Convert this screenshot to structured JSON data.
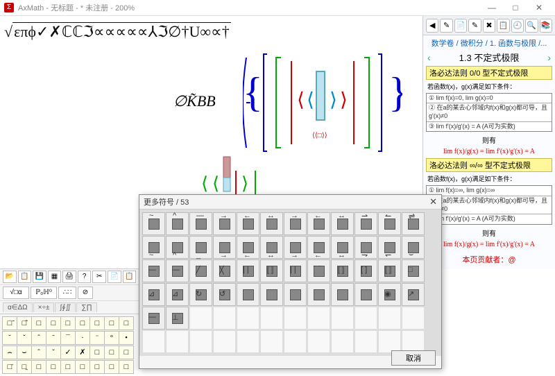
{
  "title": "AxMath - 无标题 - * 未注册 - 200%",
  "window": {
    "min": "—",
    "max": "□",
    "close": "✕"
  },
  "formula_text": "επϕ✓✗ℂℂℑ∝∝∝∝∝⅄ℑ∅†U∞∝†",
  "formula2": "∅K̃BB",
  "side": {
    "icons": [
      "◀",
      "✎",
      "📄",
      "✎",
      "✖",
      "📋",
      "🕘",
      "🔍",
      "📚"
    ],
    "crumb": "数学卷 / 微积分 / 1. 函数与极限 /...",
    "heading": "1.3 不定式极限",
    "rule1": "洛必达法则 0/0 型不定式极限",
    "cond1a": "若函数f(x)，g(x)满足如下条件：",
    "cond1b": "① lim f(x)=0, lim g(x)=0",
    "cond1c": "② 在a的某去心邻域内f(x)和g(x)都可导，且g'(x)≠0",
    "cond1d": "③ lim f'(x)/g'(x) = A  (A可为实数)",
    "then": "则有",
    "eq1": "lim f(x)/g(x) = lim f'(x)/g'(x) = A",
    "rule2": "洛必达法则 ∞/∞ 型不定式极限",
    "cond2a": "若函数f(x)，g(x)满足如下条件：",
    "cond2b": "① lim f(x)=∞, lim g(x)=∞",
    "cond2c": "② 在a的某去心邻域内f(x)和g(x)都可导，且g'(x)≠0",
    "cond2d": "③ lim f'(x)/g'(x) = A  (A可为实数)",
    "contrib": "本页贡献者：@"
  },
  "toolbar": {
    "row1": [
      "📂",
      "📋",
      "💾",
      "▦",
      "🖨",
      "?",
      "✂",
      "📄",
      "📋"
    ],
    "row2": [
      "√□α",
      "ℙ₀ℍ⁰",
      "∴∷",
      "⊘"
    ],
    "tabs": [
      "α∈ΔΩ",
      "×÷±",
      "∫∮∬",
      "∑∏"
    ]
  },
  "palette_small": [
    "□̃",
    "□̂",
    "□",
    "□",
    "□",
    "□",
    "□",
    "□",
    "□",
    "˘",
    "ˇ",
    "ˆ",
    "˜",
    "¯",
    "·",
    "¨",
    "°",
    "•",
    "⌢",
    "⌣",
    "ˆ",
    "ˇ",
    "✓",
    "✗",
    "□",
    "□",
    "□",
    "□̄",
    "□̱",
    "□",
    "□",
    "□",
    "□",
    "□",
    "□",
    "□"
  ],
  "dialog": {
    "title": "更多符号 / 53",
    "cancel": "取消",
    "decos_row1": [
      "~",
      "^",
      "—",
      "→",
      "←",
      "↔",
      "→",
      "←",
      "↔",
      "⇀",
      "↼",
      "⇌"
    ],
    "decos_row2": [
      "~",
      "^",
      "_",
      "→",
      "←",
      "↔",
      "→",
      "←",
      "↔",
      "⇁",
      "↽",
      "⌣"
    ],
    "decos_row3": [
      "—",
      "—",
      "╱",
      "╳",
      "| |",
      "⟦⟧",
      "| |",
      "‾  ‾",
      "⟦⟧",
      "[ ]",
      "⟦⟧",
      "□"
    ],
    "decos_row4": [
      "⊿",
      "⊿",
      "↻",
      "↺",
      "",
      "",
      "",
      "",
      "",
      "",
      "◉",
      "↗"
    ],
    "decos_row5": [
      "—",
      "⊥"
    ]
  }
}
